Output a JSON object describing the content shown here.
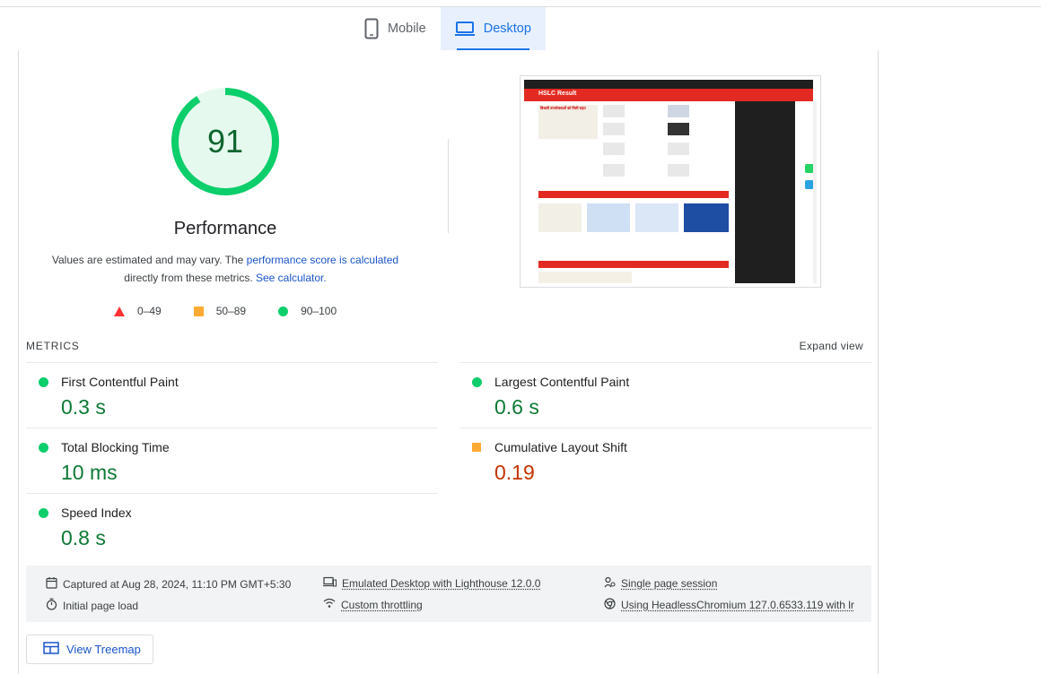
{
  "tabs": [
    {
      "label": "Mobile",
      "icon": "smartphone-icon",
      "active": false
    },
    {
      "label": "Desktop",
      "icon": "laptop-icon",
      "active": true
    }
  ],
  "performance": {
    "score": "91",
    "score_fraction": 0.91,
    "title": "Performance",
    "desc_prefix": "Values are estimated and may vary. The ",
    "desc_link1": "performance score is calculated",
    "desc_middle": " directly from these metrics. ",
    "desc_link2": "See calculator.",
    "color": "#0cce6b"
  },
  "legend": [
    {
      "range": "0–49",
      "shape": "triangle",
      "color": "#ff3333"
    },
    {
      "range": "50–89",
      "shape": "square",
      "color": "#ffaa33"
    },
    {
      "range": "90–100",
      "shape": "circle",
      "color": "#0cce6b"
    }
  ],
  "screenshot": {
    "site_title": "HSLC Result",
    "headline": "बिजली उपभोक्ताओं को मिली राहत"
  },
  "metrics": {
    "label": "METRICS",
    "expand": "Expand view",
    "items": [
      {
        "name": "First Contentful Paint",
        "value": "0.3 s",
        "rating": "good"
      },
      {
        "name": "Largest Contentful Paint",
        "value": "0.6 s",
        "rating": "good"
      },
      {
        "name": "Total Blocking Time",
        "value": "10 ms",
        "rating": "good"
      },
      {
        "name": "Cumulative Layout Shift",
        "value": "0.19",
        "rating": "average"
      },
      {
        "name": "Speed Index",
        "value": "0.8 s",
        "rating": "good"
      }
    ]
  },
  "info": {
    "captured": "Captured at Aug 28, 2024, 11:10 PM GMT+5:30",
    "initial_load": "Initial page load",
    "emulated": "Emulated Desktop with Lighthouse 12.0.0",
    "throttling": "Custom throttling",
    "session": "Single page session",
    "browser": "Using HeadlessChromium 127.0.6533.119 with lr"
  },
  "treemap": {
    "label": "View Treemap"
  }
}
